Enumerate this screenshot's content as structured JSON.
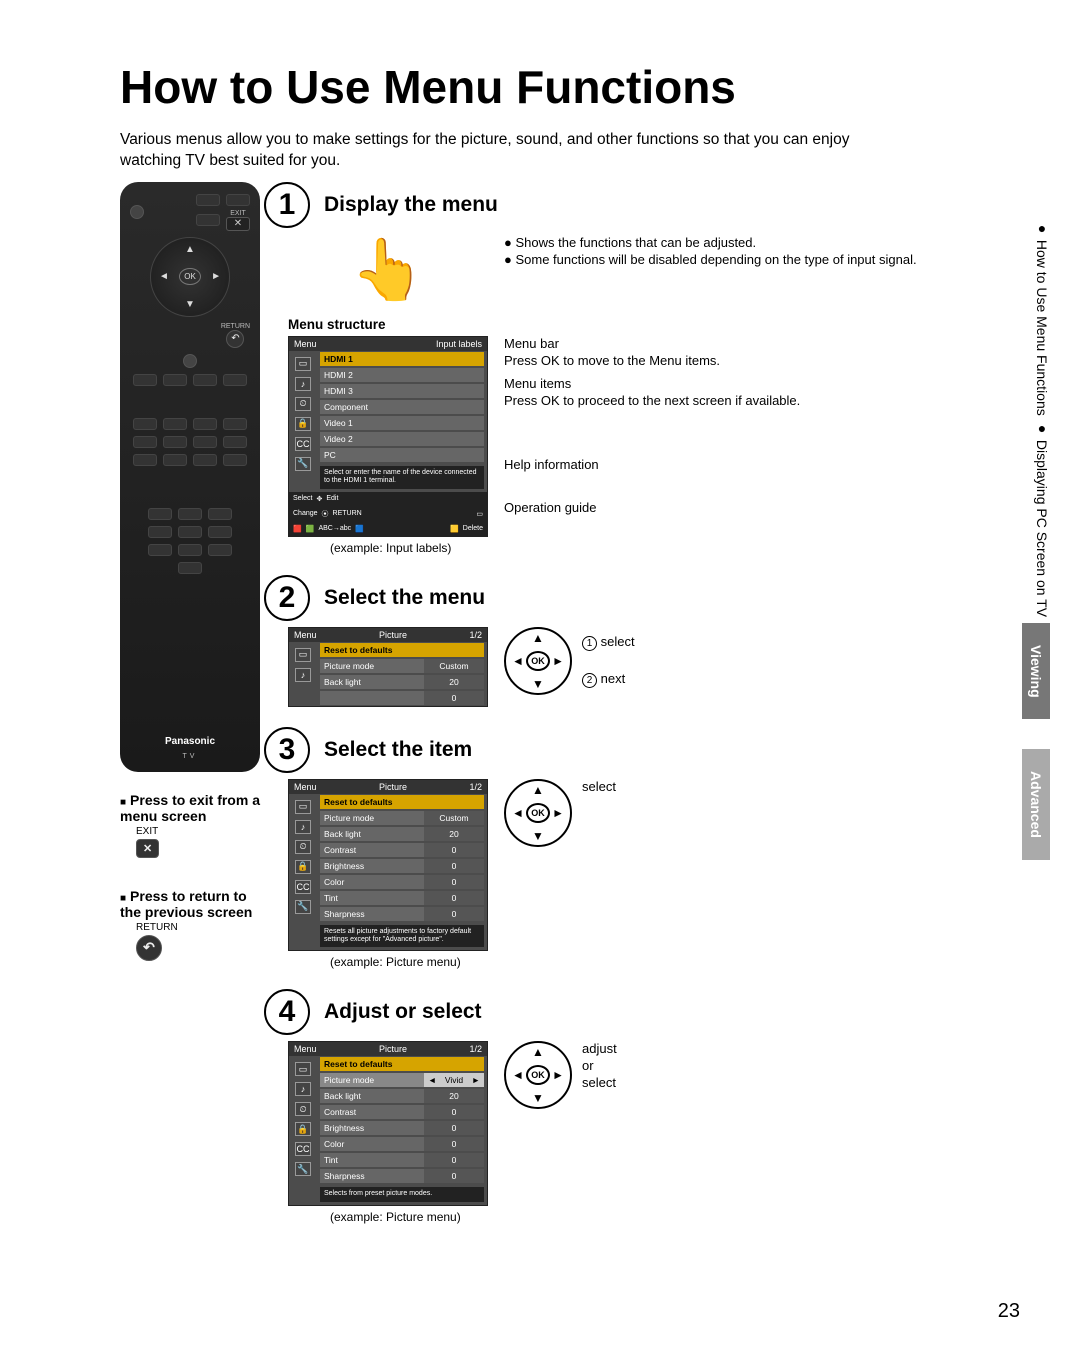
{
  "title": "How to Use Menu Functions",
  "intro": "Various menus allow you to make settings for the picture, sound, and other functions so that you can enjoy watching TV best suited for you.",
  "remote": {
    "brand": "Panasonic",
    "tv": "TV",
    "exit": "EXIT",
    "return": "RETURN",
    "ok": "OK"
  },
  "under_remote": {
    "exit_title": "Press to exit from a menu screen",
    "exit_label": "EXIT",
    "return_title": "Press to return to the previous screen",
    "return_label": "RETURN"
  },
  "steps": {
    "s1": {
      "title": "Display the menu",
      "bullets": [
        "Shows the functions that can be adjusted.",
        "Some functions will be disabled depending on the type of input signal."
      ],
      "sub": "Menu structure",
      "menu_header_left": "Menu",
      "menu_header_right": "Input labels",
      "items": [
        "HDMI 1",
        "HDMI 2",
        "HDMI 3",
        "Component",
        "Video 1",
        "Video 2",
        "PC"
      ],
      "help": "Select or enter the name of the device connected to the HDMI 1 terminal.",
      "footer": {
        "select": "Select",
        "change": "Change",
        "edit": "Edit",
        "return": "RETURN",
        "abc": "ABC→abc",
        "delete": "Delete"
      },
      "example": "(example: Input labels)",
      "annotations": {
        "bar": "Menu bar",
        "bar2": "Press OK to move to the Menu items.",
        "items": "Menu items",
        "items2": "Press OK to proceed to the next screen if available.",
        "help": "Help information",
        "guide": "Operation guide"
      }
    },
    "s2": {
      "title": "Select the menu",
      "header_left": "Menu",
      "header_mid": "Picture",
      "header_right": "1/2",
      "rows": [
        {
          "lab": "Reset to defaults",
          "val": ""
        },
        {
          "lab": "Picture mode",
          "val": "Custom"
        },
        {
          "lab": "Back light",
          "val": "20"
        },
        {
          "lab": "",
          "val": "0"
        }
      ],
      "dp1": "select",
      "dp2": "next"
    },
    "s3": {
      "title": "Select the item",
      "header_left": "Menu",
      "header_mid": "Picture",
      "header_right": "1/2",
      "rows": [
        {
          "lab": "Reset to defaults",
          "val": ""
        },
        {
          "lab": "Picture mode",
          "val": "Custom"
        },
        {
          "lab": "Back light",
          "val": "20"
        },
        {
          "lab": "Contrast",
          "val": "0"
        },
        {
          "lab": "Brightness",
          "val": "0"
        },
        {
          "lab": "Color",
          "val": "0"
        },
        {
          "lab": "Tint",
          "val": "0"
        },
        {
          "lab": "Sharpness",
          "val": "0"
        }
      ],
      "help": "Resets all picture adjustments to factory default settings except for \"Advanced picture\".",
      "example": "(example:  Picture menu)",
      "dp": "select"
    },
    "s4": {
      "title": "Adjust or select",
      "header_left": "Menu",
      "header_mid": "Picture",
      "header_right": "1/2",
      "rows": [
        {
          "lab": "Reset to defaults",
          "val": ""
        },
        {
          "lab": "Picture mode",
          "val": "Vivid"
        },
        {
          "lab": "Back light",
          "val": "20"
        },
        {
          "lab": "Contrast",
          "val": "0"
        },
        {
          "lab": "Brightness",
          "val": "0"
        },
        {
          "lab": "Color",
          "val": "0"
        },
        {
          "lab": "Tint",
          "val": "0"
        },
        {
          "lab": "Sharpness",
          "val": "0"
        }
      ],
      "help": "Selects from preset picture modes.",
      "example": "(example:  Picture menu)",
      "dp1": "adjust",
      "dp2": "or",
      "dp3": "select"
    }
  },
  "side": {
    "bullets": [
      "How to Use Menu Functions",
      "Displaying PC Screen on TV"
    ],
    "viewing": "Viewing",
    "advanced": "Advanced"
  },
  "page": "23",
  "ok": "OK"
}
